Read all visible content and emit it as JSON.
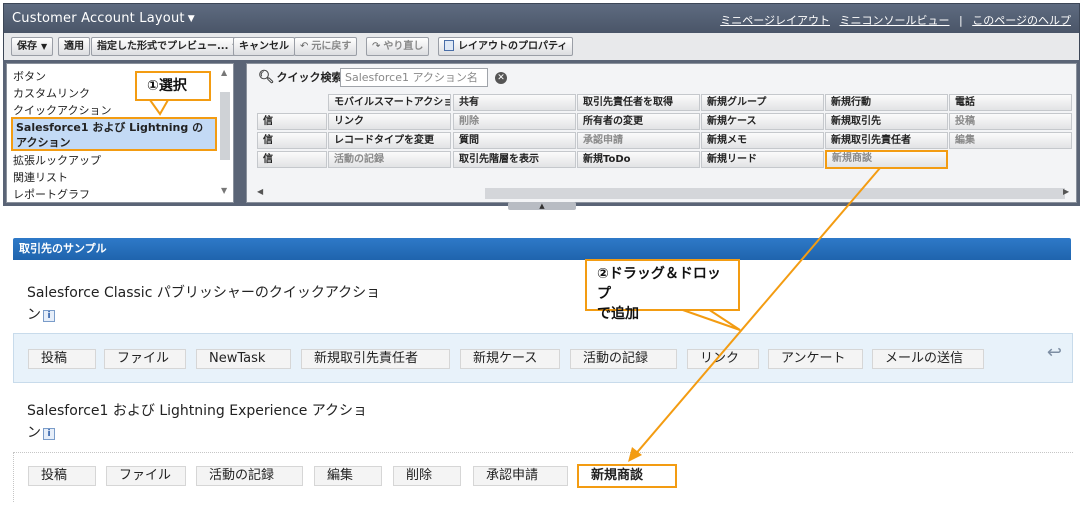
{
  "header": {
    "title": "Customer Account Layout",
    "links": [
      "ミニページレイアウト",
      "ミニコンソールビュー",
      "このページのヘルプ"
    ],
    "separator": "|"
  },
  "toolbar": {
    "save": "保存",
    "apply": "適用",
    "preview": "指定した形式でプレビュー...",
    "cancel": "キャンセル",
    "undo": "元に戻す",
    "redo": "やり直し",
    "properties": "レイアウトのプロパティ"
  },
  "palette": {
    "categories": [
      "ボタン",
      "カスタムリンク",
      "クイックアクション",
      "Salesforce1 および Lightning のアクション",
      "拡張ルックアップ",
      "関連リスト",
      "レポートグラフ"
    ],
    "quick_search_label": "クイック検索",
    "quick_search_placeholder": "Salesforce1 アクション名",
    "rows": [
      [
        "",
        "モバイルスマートアクション",
        "共有",
        "取引先責任者を取得",
        "新規グループ",
        "新規行動",
        "電話"
      ],
      [
        "信",
        "リンク",
        "削除",
        "所有者の変更",
        "新規ケース",
        "新規取引先",
        "投稿"
      ],
      [
        "信",
        "レコードタイプを変更",
        "質問",
        "承認申請",
        "新規メモ",
        "新規取引先責任者",
        "編集"
      ],
      [
        "信",
        "活動の記録",
        "取引先階層を表示",
        "新規ToDo",
        "新規リード",
        "新規商談",
        ""
      ]
    ]
  },
  "section": {
    "title": "取引先のサンプル",
    "classic_title": "Salesforce Classic パブリッシャーのクイックアクショ",
    "classic_title_tail": "ン",
    "classic_actions": [
      "投稿",
      "ファイル",
      "NewTask",
      "新規取引先責任者",
      "新規ケース",
      "活動の記録",
      "リンク",
      "アンケート",
      "メールの送信"
    ],
    "lightning_title": "Salesforce1 および Lightning Experience アクショ",
    "lightning_title_tail": "ン",
    "lightning_actions": [
      "投稿",
      "ファイル",
      "活動の記録",
      "編集",
      "削除",
      "承認申請",
      "新規商談"
    ],
    "info_glyph": "i"
  },
  "callouts": {
    "step1": "①選択",
    "step2_line1": "②ドラッグ＆ドロップ",
    "step2_line2": "で追加"
  },
  "colors": {
    "accent": "#f39c12",
    "header_bg": "#5e6b80",
    "section_bar": "#2e79c8"
  }
}
